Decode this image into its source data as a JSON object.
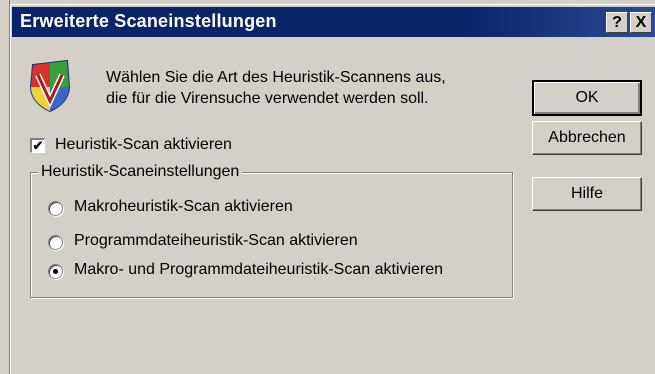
{
  "window": {
    "title": "Erweiterte Scaneinstellungen",
    "help_button": "?",
    "close_button": "X"
  },
  "intro": {
    "line1": "Wählen Sie die Art des Heuristik-Scannens aus,",
    "line2": "die für die Virensuche verwendet werden soll."
  },
  "checkbox": {
    "label": "Heuristik-Scan aktivieren",
    "checked": true,
    "mark": "✔"
  },
  "group": {
    "legend": "Heuristik-Scaneinstellungen",
    "options": [
      {
        "label": "Makroheuristik-Scan aktivieren",
        "selected": false
      },
      {
        "label": "Programmdateiheuristik-Scan aktivieren",
        "selected": false
      },
      {
        "label": "Makro- und Programmdateiheuristik-Scan aktivieren",
        "selected": true
      }
    ]
  },
  "buttons": {
    "ok": "OK",
    "cancel": "Abbrechen",
    "help": "Hilfe"
  },
  "colors": {
    "titlebar": "#0a246a",
    "face": "#d4d0c8"
  },
  "icons": {
    "app": "shield-v-icon"
  }
}
